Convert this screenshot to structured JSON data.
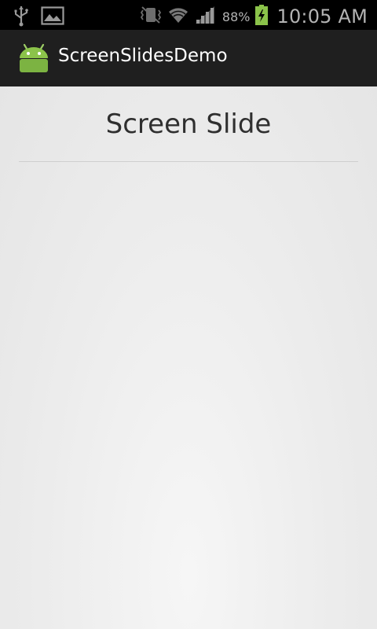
{
  "status_bar": {
    "battery_percent": "88%",
    "time": "10:05 AM",
    "left_icons": [
      "usb-icon",
      "image-icon"
    ],
    "right_icons": [
      "vibrate-icon",
      "wifi-icon",
      "signal-icon",
      "battery-icon"
    ],
    "battery_level": 0.88
  },
  "action_bar": {
    "title": "ScreenSlidesDemo",
    "icon": "android-icon"
  },
  "content": {
    "title": "Screen Slide"
  }
}
